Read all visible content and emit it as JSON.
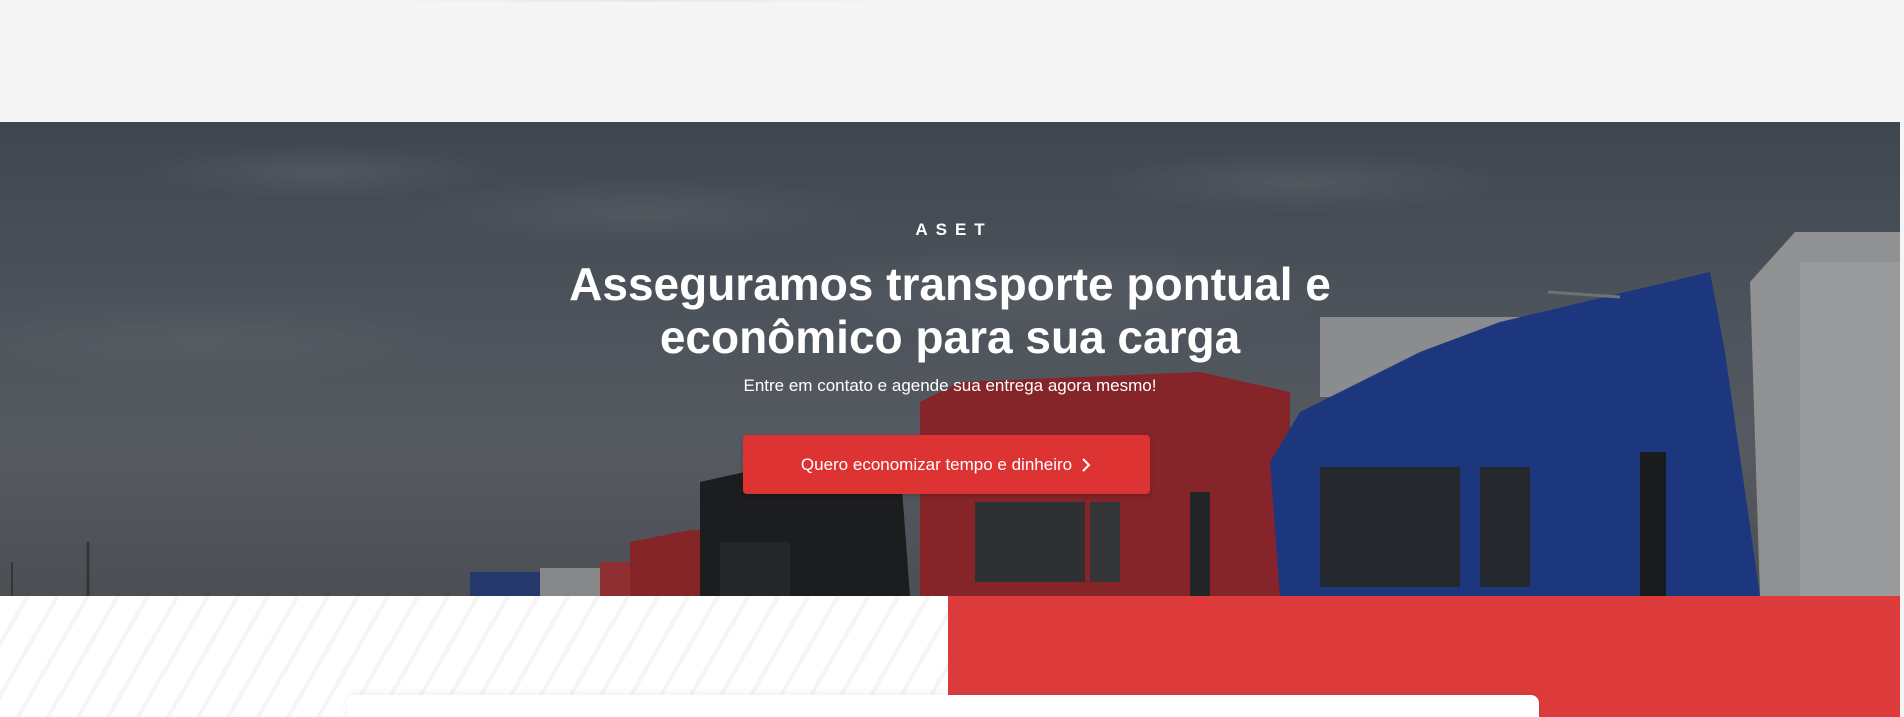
{
  "hero": {
    "eyebrow": "ASET",
    "headline_line1": "Asseguramos transporte pontual e",
    "headline_line2": "econômico para sua carga",
    "subtitle": "Entre em contato e agende sua entrega agora mesmo!",
    "cta_label": "Quero economizar tempo e dinheiro",
    "cta_icon": "chevron-right-icon"
  },
  "colors": {
    "accent_red": "#dd3333",
    "band_red": "#dd3b3b",
    "page_bg": "#f5f5f5",
    "text_on_hero": "#ffffff"
  }
}
